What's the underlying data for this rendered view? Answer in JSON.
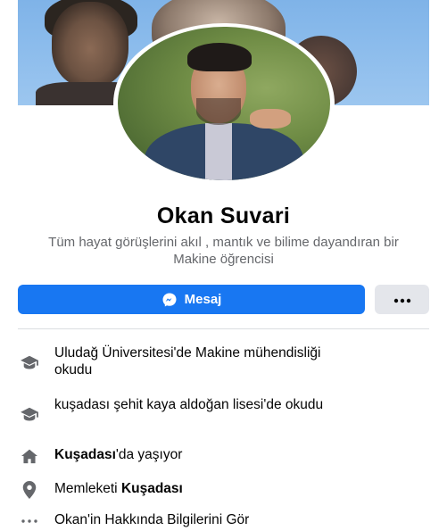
{
  "profile": {
    "name": "Okan Suvari",
    "bio": "Tüm hayat görüşlerini akıl , mantık ve bilime dayandıran bir Makine öğrencisi"
  },
  "actions": {
    "message_label": "Mesaj",
    "message_icon": "messenger-icon",
    "more_icon": "more-dots-icon"
  },
  "details": {
    "education_1": {
      "icon": "graduation-cap-icon",
      "text": "Uludağ Üniversitesi'de Makine mühendisliği okudu"
    },
    "education_2": {
      "icon": "graduation-cap-icon",
      "text": "kuşadası şehit kaya aldoğan lisesi'de okudu"
    },
    "lives_in": {
      "icon": "home-icon",
      "place": "Kuşadası",
      "suffix": "'da yaşıyor"
    },
    "hometown": {
      "icon": "location-pin-icon",
      "prefix": "Memleketi ",
      "place": "Kuşadası"
    },
    "see_about": {
      "icon": "more-dots-icon",
      "text": "Okan'in Hakkında Bilgilerini Gör"
    }
  },
  "colors": {
    "primary": "#1877f2",
    "secondary_button": "#e4e6eb",
    "text": "#050505",
    "muted_text": "#65676b",
    "icon": "#65676b"
  }
}
